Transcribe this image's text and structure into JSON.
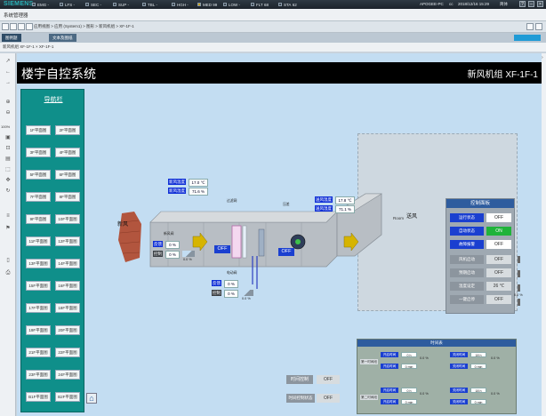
{
  "topbar": {
    "logo": "SIEMENS",
    "status": [
      {
        "label": "EMG",
        "value": "-"
      },
      {
        "label": "LFS",
        "value": "-"
      },
      {
        "label": "SEC",
        "value": "-"
      },
      {
        "label": "SUP",
        "value": "-"
      },
      {
        "label": "TBL",
        "value": "-"
      },
      {
        "label": "HGH",
        "value": "-"
      },
      {
        "label": "MED",
        "value": "99"
      },
      {
        "label": "LOW",
        "value": "-"
      },
      {
        "label": "FLT",
        "value": "68"
      },
      {
        "label": "STA",
        "value": "62"
      }
    ],
    "host": "APOGEE-PC",
    "user": "cc",
    "datetime": "2018/12/16 15:29",
    "lang": "简体"
  },
  "app_title": "系统管理器",
  "breadcrumb": "应用视图 > 应用 (System1) > 图形 > 新风机组 > XF-1F-1",
  "tabs": [
    "图例题",
    "文本及图纸"
  ],
  "subtab": "新风机组 XF-1F-1 ×  XF-1F-1",
  "zoom": "100%",
  "header": {
    "title": "楼宇自控系统",
    "subtitle": "新风机组 XF-1F-1"
  },
  "nav": {
    "title": "导航栏",
    "left": [
      "1F平面图",
      "3F平面图",
      "5F平面图",
      "7F平面图",
      "9F平面图",
      "11F平面图",
      "13F平面图",
      "15F平面图",
      "17F平面图",
      "19F平面图",
      "21F平面图",
      "23F平面图",
      "B1F平面图"
    ],
    "right": [
      "2F平面图",
      "4F平面图",
      "6F平面图",
      "8F平面图",
      "10F平面图",
      "12F平面图",
      "14F平面图",
      "16F平面图",
      "18F平面图",
      "20F平面图",
      "22F平面图",
      "24F平面图",
      "B2F平面图"
    ]
  },
  "diagram": {
    "fresh_air": "新风",
    "supply_air": "送风",
    "room": "Room",
    "outdoor_temp_label": "新风温度",
    "outdoor_temp": "17.0 ℃",
    "outdoor_hum_label": "新风湿度",
    "outdoor_hum": "71.6 %",
    "damper_label": "新风阀",
    "feedback_label": "反馈",
    "feedback_value": "0 %",
    "control_label": "控制",
    "control_value": "0 %",
    "slider_pct": "0.0 %",
    "filter_label": "过滤网",
    "filter_state": "OFF",
    "fan_label": "压差",
    "fan_state": "OFF",
    "valve_label": "电动阀",
    "valve_fb_label": "反馈",
    "valve_fb": "0 %",
    "valve_ctrl_label": "控制",
    "valve_ctrl": "0 %",
    "valve_slider_pct": "0.0 %",
    "supply_temp_label": "送风温度",
    "supply_temp": "17.8 ℃",
    "supply_hum_label": "送风湿度",
    "supply_hum": "71.1 %"
  },
  "control_panel": {
    "title": "控制面板",
    "rows": [
      {
        "label": "运行状态",
        "value": "OFF",
        "kind": "status"
      },
      {
        "label": "自动状态",
        "value": "ON",
        "kind": "on"
      },
      {
        "label": "故障报警",
        "value": "OFF",
        "kind": "status"
      },
      {
        "label": "风机启动",
        "value": "OFF",
        "kind": "cmd"
      },
      {
        "label": "预期启动",
        "value": "OFF",
        "kind": "cmd"
      },
      {
        "label": "温度设定",
        "value": "26 ℃",
        "kind": "cmd"
      },
      {
        "label": "一键启停",
        "value": "OFF",
        "kind": "cmd"
      }
    ],
    "slider_pct": "0.0 %"
  },
  "schedule": {
    "title": "时间表",
    "group1": "第一时间段",
    "group2": "第二时间段",
    "on_time_label": "开启时间",
    "off_time_label": "关闭时间",
    "time_pct": "0.0 %",
    "g1": {
      "on_h": "0 h",
      "on_min": "0 min",
      "off_h": "18 h",
      "off_min": "0 min"
    },
    "g2": {
      "on_h": "0 h",
      "on_min": "0 min",
      "off_h": "18 h",
      "off_min": "0 min"
    }
  },
  "bottom": {
    "time_ctrl_label": "时间控制",
    "time_ctrl_value": "OFF",
    "time_ctrl_state_label": "时间控制状态",
    "time_ctrl_state_value": "OFF"
  }
}
